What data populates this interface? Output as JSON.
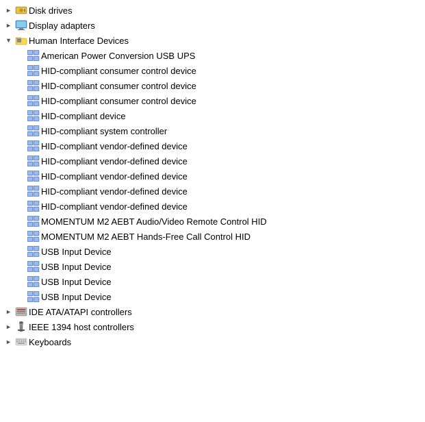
{
  "tree": {
    "items": [
      {
        "id": "disk-drives",
        "label": "Disk drives",
        "indent": 0,
        "expanded": false,
        "hasChildren": true,
        "iconType": "disk",
        "expandState": "collapsed"
      },
      {
        "id": "display-adapters",
        "label": "Display adapters",
        "indent": 0,
        "expanded": false,
        "hasChildren": true,
        "iconType": "display",
        "expandState": "collapsed"
      },
      {
        "id": "human-interface-devices",
        "label": "Human Interface Devices",
        "indent": 0,
        "expanded": true,
        "hasChildren": true,
        "iconType": "hid-folder",
        "expandState": "expanded"
      },
      {
        "id": "apc-usb-ups",
        "label": "American Power Conversion USB UPS",
        "indent": 1,
        "expanded": false,
        "hasChildren": false,
        "iconType": "hid",
        "expandState": "none"
      },
      {
        "id": "hid-consumer-1",
        "label": "HID-compliant consumer control device",
        "indent": 1,
        "expanded": false,
        "hasChildren": false,
        "iconType": "hid",
        "expandState": "none"
      },
      {
        "id": "hid-consumer-2",
        "label": "HID-compliant consumer control device",
        "indent": 1,
        "expanded": false,
        "hasChildren": false,
        "iconType": "hid",
        "expandState": "none"
      },
      {
        "id": "hid-consumer-3",
        "label": "HID-compliant consumer control device",
        "indent": 1,
        "expanded": false,
        "hasChildren": false,
        "iconType": "hid",
        "expandState": "none"
      },
      {
        "id": "hid-device",
        "label": "HID-compliant device",
        "indent": 1,
        "expanded": false,
        "hasChildren": false,
        "iconType": "hid",
        "expandState": "none"
      },
      {
        "id": "hid-system-controller",
        "label": "HID-compliant system controller",
        "indent": 1,
        "expanded": false,
        "hasChildren": false,
        "iconType": "hid",
        "expandState": "none"
      },
      {
        "id": "hid-vendor-1",
        "label": "HID-compliant vendor-defined device",
        "indent": 1,
        "expanded": false,
        "hasChildren": false,
        "iconType": "hid",
        "expandState": "none"
      },
      {
        "id": "hid-vendor-2",
        "label": "HID-compliant vendor-defined device",
        "indent": 1,
        "expanded": false,
        "hasChildren": false,
        "iconType": "hid",
        "expandState": "none"
      },
      {
        "id": "hid-vendor-3",
        "label": "HID-compliant vendor-defined device",
        "indent": 1,
        "expanded": false,
        "hasChildren": false,
        "iconType": "hid",
        "expandState": "none"
      },
      {
        "id": "hid-vendor-4",
        "label": "HID-compliant vendor-defined device",
        "indent": 1,
        "expanded": false,
        "hasChildren": false,
        "iconType": "hid",
        "expandState": "none"
      },
      {
        "id": "hid-vendor-5",
        "label": "HID-compliant vendor-defined device",
        "indent": 1,
        "expanded": false,
        "hasChildren": false,
        "iconType": "hid",
        "expandState": "none"
      },
      {
        "id": "momentum-m2-av",
        "label": "MOMENTUM M2 AEBT Audio/Video Remote Control HID",
        "indent": 1,
        "expanded": false,
        "hasChildren": false,
        "iconType": "hid",
        "expandState": "none"
      },
      {
        "id": "momentum-m2-hf",
        "label": "MOMENTUM M2 AEBT Hands-Free Call Control HID",
        "indent": 1,
        "expanded": false,
        "hasChildren": false,
        "iconType": "hid",
        "expandState": "none"
      },
      {
        "id": "usb-input-1",
        "label": "USB Input Device",
        "indent": 1,
        "expanded": false,
        "hasChildren": false,
        "iconType": "hid",
        "expandState": "none"
      },
      {
        "id": "usb-input-2",
        "label": "USB Input Device",
        "indent": 1,
        "expanded": false,
        "hasChildren": false,
        "iconType": "hid",
        "expandState": "none"
      },
      {
        "id": "usb-input-3",
        "label": "USB Input Device",
        "indent": 1,
        "expanded": false,
        "hasChildren": false,
        "iconType": "hid",
        "expandState": "none"
      },
      {
        "id": "usb-input-4",
        "label": "USB Input Device",
        "indent": 1,
        "expanded": false,
        "hasChildren": false,
        "iconType": "hid",
        "expandState": "none"
      },
      {
        "id": "ide-ata",
        "label": "IDE ATA/ATAPI controllers",
        "indent": 0,
        "expanded": false,
        "hasChildren": true,
        "iconType": "ide",
        "expandState": "collapsed"
      },
      {
        "id": "ieee-1394",
        "label": "IEEE 1394 host controllers",
        "indent": 0,
        "expanded": false,
        "hasChildren": true,
        "iconType": "ieee",
        "expandState": "collapsed"
      },
      {
        "id": "keyboards",
        "label": "Keyboards",
        "indent": 0,
        "expanded": false,
        "hasChildren": true,
        "iconType": "keyboard",
        "expandState": "collapsed"
      }
    ]
  }
}
